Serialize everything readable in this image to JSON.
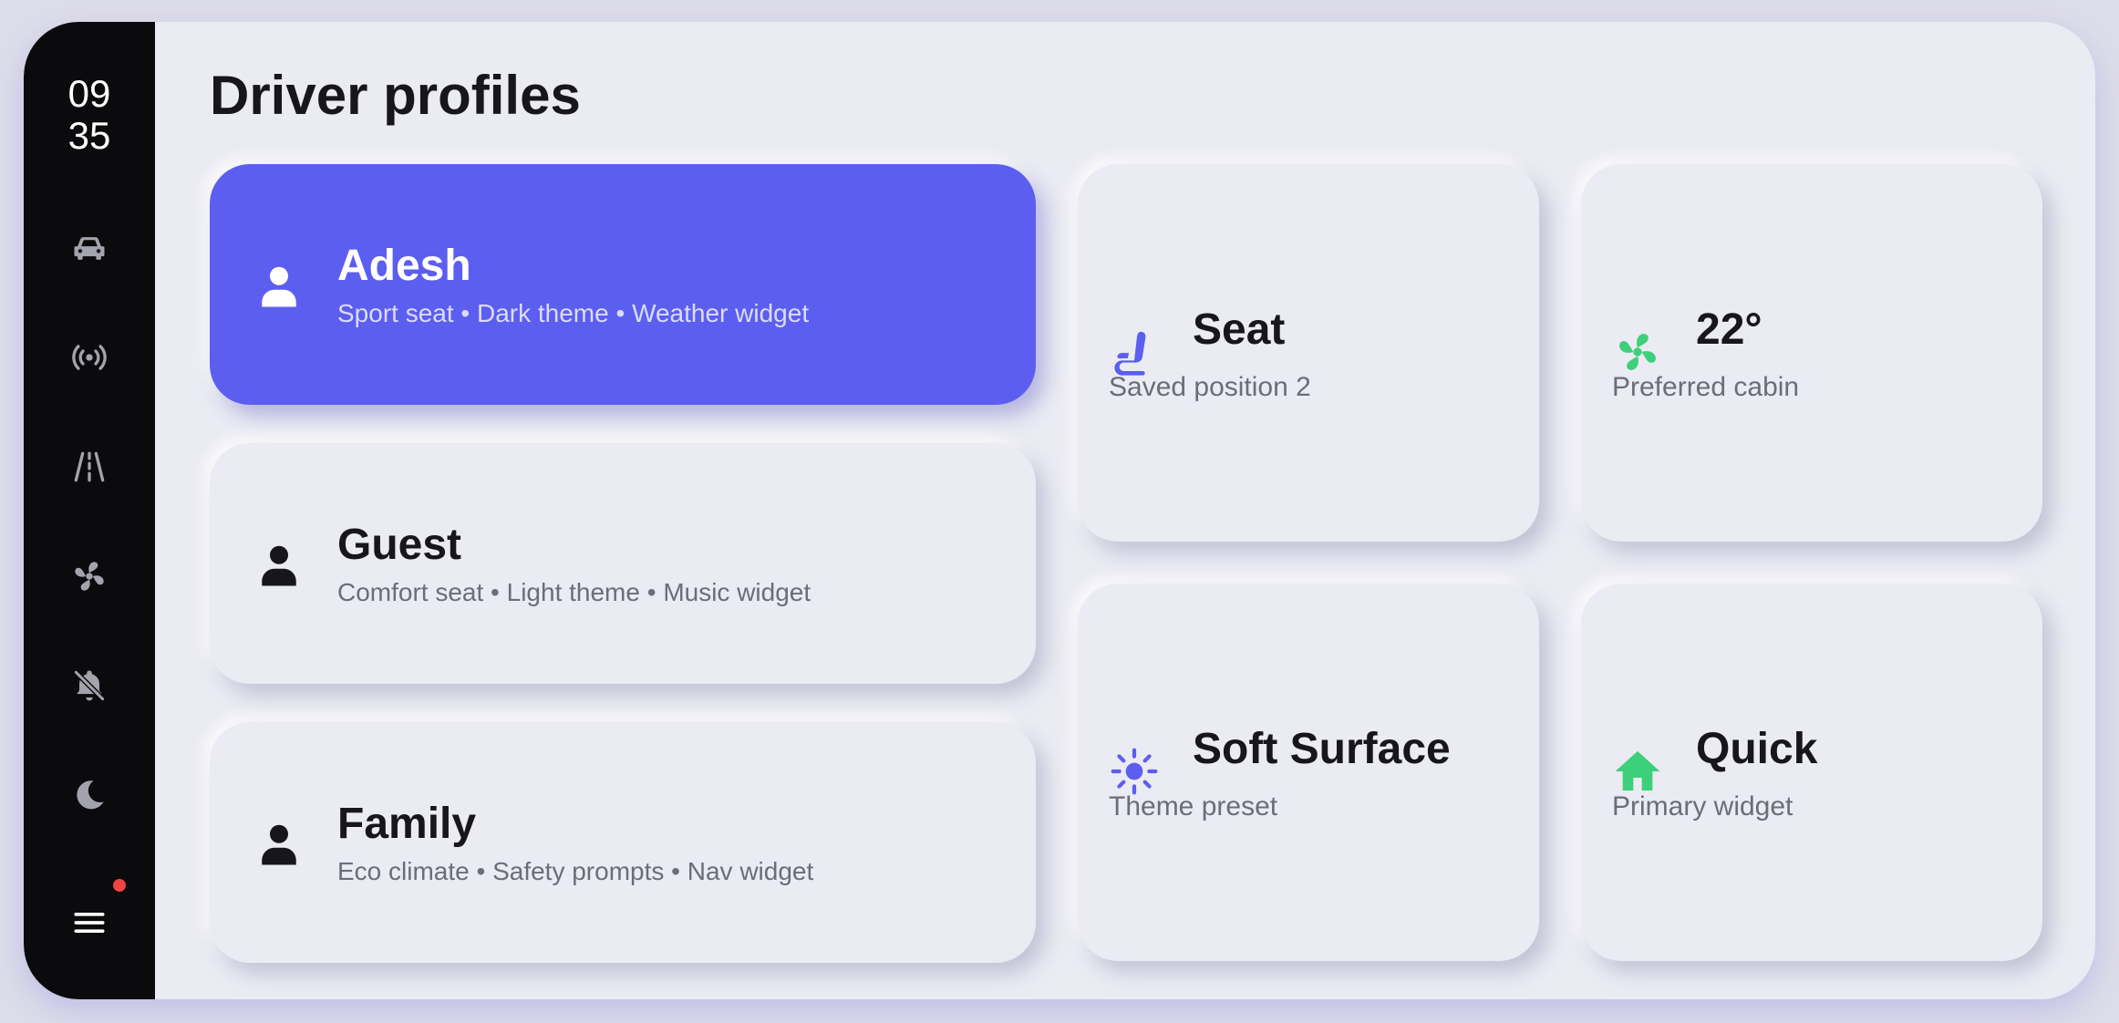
{
  "clock": {
    "hours": "09",
    "minutes": "35"
  },
  "rail": {
    "items": [
      {
        "name": "car-icon"
      },
      {
        "name": "broadcast-icon"
      },
      {
        "name": "road-icon"
      },
      {
        "name": "fan-icon"
      },
      {
        "name": "bell-off-icon"
      },
      {
        "name": "moon-icon"
      },
      {
        "name": "menu-icon"
      }
    ],
    "notification_dot_color": "#ef4444"
  },
  "page": {
    "title": "Driver profiles"
  },
  "profiles": [
    {
      "name": "Adesh",
      "desc": "Sport seat • Dark theme • Weather widget",
      "active": true
    },
    {
      "name": "Guest",
      "desc": "Comfort seat • Light theme • Music widget",
      "active": false
    },
    {
      "name": "Family",
      "desc": "Eco climate • Safety prompts • Nav widget",
      "active": false
    }
  ],
  "tiles": {
    "seat": {
      "title": "Seat",
      "subtitle": "Saved position 2",
      "icon": "seat-icon",
      "color": "#5c5ef0"
    },
    "climate": {
      "title": "22°",
      "subtitle": "Preferred cabin",
      "icon": "fan-icon",
      "color": "#3ecf7a"
    },
    "theme": {
      "title": "Soft Surface",
      "subtitle": "Theme preset",
      "icon": "sun-icon",
      "color": "#5c5ef0"
    },
    "widget": {
      "title": "Quick",
      "subtitle": "Primary widget",
      "icon": "home-icon",
      "color": "#3ecf7a"
    }
  },
  "colors": {
    "accent": "#5c5ef0",
    "green": "#3ecf7a",
    "rail": "#0b0b0d",
    "surface": "#ebebf3"
  }
}
